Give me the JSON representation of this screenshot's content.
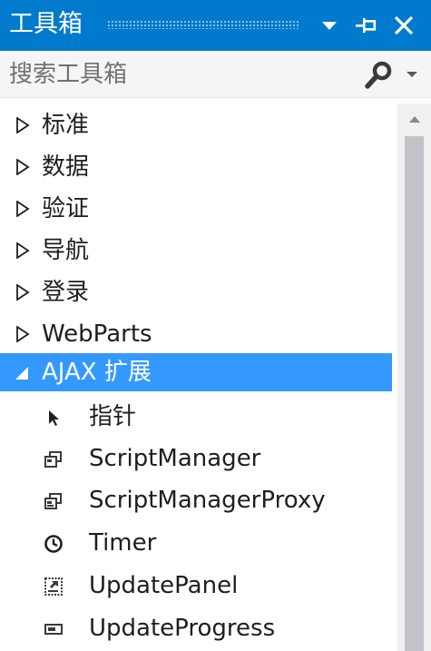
{
  "window": {
    "title": "工具箱"
  },
  "search": {
    "placeholder": "搜索工具箱"
  },
  "categories": [
    {
      "label": "标准",
      "expanded": false
    },
    {
      "label": "数据",
      "expanded": false
    },
    {
      "label": "验证",
      "expanded": false
    },
    {
      "label": "导航",
      "expanded": false
    },
    {
      "label": "登录",
      "expanded": false
    },
    {
      "label": "WebParts",
      "expanded": false
    },
    {
      "label": "AJAX 扩展",
      "expanded": true,
      "selected": true
    }
  ],
  "ajax_items": [
    {
      "label": "指针",
      "icon": "pointer-icon"
    },
    {
      "label": "ScriptManager",
      "icon": "script-manager-icon"
    },
    {
      "label": "ScriptManagerProxy",
      "icon": "script-manager-proxy-icon"
    },
    {
      "label": "Timer",
      "icon": "timer-icon"
    },
    {
      "label": "UpdatePanel",
      "icon": "update-panel-icon"
    },
    {
      "label": "UpdateProgress",
      "icon": "update-progress-icon"
    }
  ],
  "colors": {
    "titlebar": "#007acc",
    "selection": "#3399ff",
    "text": "#1e1e1e",
    "scroll_thumb": "#c2c3c9"
  }
}
